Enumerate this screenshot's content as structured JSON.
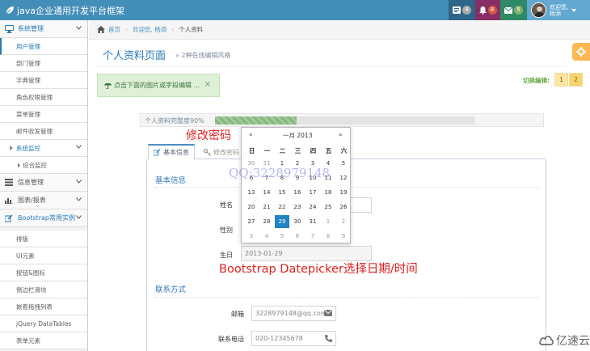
{
  "navbar": {
    "brand": "java企业通用开发平台框架",
    "bg_color": "#438eb9",
    "tasks_icon": "tasks-icon",
    "tasks_count": "4",
    "notifications_icon": "bell-icon",
    "notifications_count": "8",
    "messages_icon": "envelope-icon",
    "messages_count": "5",
    "welcome": "欢迎您,",
    "username": "杨添"
  },
  "sidebar": {
    "items": [
      {
        "label": "系统管理",
        "icon": "desktop-icon"
      },
      {
        "label": "用户管理"
      },
      {
        "label": "部门管理"
      },
      {
        "label": "字典管理"
      },
      {
        "label": "角色权限管理"
      },
      {
        "label": "菜单管理"
      },
      {
        "label": "邮件收发管理"
      },
      {
        "label": "系统监控"
      },
      {
        "label": "综合监控"
      },
      {
        "label": "信息管理",
        "icon": "list-icon"
      },
      {
        "label": "图表/报表",
        "icon": "chart-icon"
      },
      {
        "label": "Bootstrap常用实例",
        "icon": "edit-icon"
      },
      {
        "label": "排版"
      },
      {
        "label": "UI元素"
      },
      {
        "label": "按钮&图标"
      },
      {
        "label": "侧边栏滑块"
      },
      {
        "label": "嵌套拖拽列表"
      },
      {
        "label": "jQuery DataTables"
      },
      {
        "label": "表单元素"
      }
    ]
  },
  "breadcrumb": {
    "home": "首页",
    "welcome": "欢迎您, 杨添",
    "current": "个人资料"
  },
  "header": {
    "title": "个人资料页面",
    "subtitle": "» 2种在线编辑风格"
  },
  "alert": {
    "text": "点击下面的图片或字段编辑 ...",
    "close": "×"
  },
  "switch": {
    "label": "切换编辑:",
    "options": [
      "1",
      "2"
    ]
  },
  "progress": {
    "label": "个人资料完整度90%",
    "percent": 90,
    "color": "#87b87f"
  },
  "tabs": {
    "basic": "基本信息",
    "password": "修改密码"
  },
  "form": {
    "basic_section": "基本信息",
    "name_label": "姓名",
    "gender_label": "性别",
    "birthday_label": "生日",
    "birthday_value": "2013-01-29",
    "contact_section": "联系方式",
    "email_label": "邮箱",
    "email_value": "3228979148@qq.com",
    "phone_label": "联系电话",
    "phone_value": "020-12345678"
  },
  "datepicker": {
    "prev": "«",
    "month": "一月 2013",
    "next": "»",
    "weekdays": [
      "日",
      "一",
      "二",
      "三",
      "四",
      "五",
      "六"
    ],
    "weeks": [
      [
        "30",
        "31",
        "1",
        "2",
        "3",
        "4",
        "5"
      ],
      [
        "6",
        "7",
        "8",
        "9",
        "10",
        "11",
        "12"
      ],
      [
        "13",
        "14",
        "15",
        "16",
        "17",
        "18",
        "19"
      ],
      [
        "20",
        "21",
        "22",
        "23",
        "24",
        "25",
        "26"
      ],
      [
        "27",
        "28",
        "29",
        "30",
        "31",
        "1",
        "2"
      ],
      [
        "3",
        "4",
        "5",
        "6",
        "7",
        "8",
        "9"
      ]
    ],
    "selected": "29",
    "accent_color": "#2283c5"
  },
  "overlay": {
    "change_password": "修改密码",
    "qq": "QQ:3228979148",
    "datepicker_caption": "Bootstrap Datepicker选择日期/时间"
  },
  "watermark": {
    "text": "亿速云"
  }
}
